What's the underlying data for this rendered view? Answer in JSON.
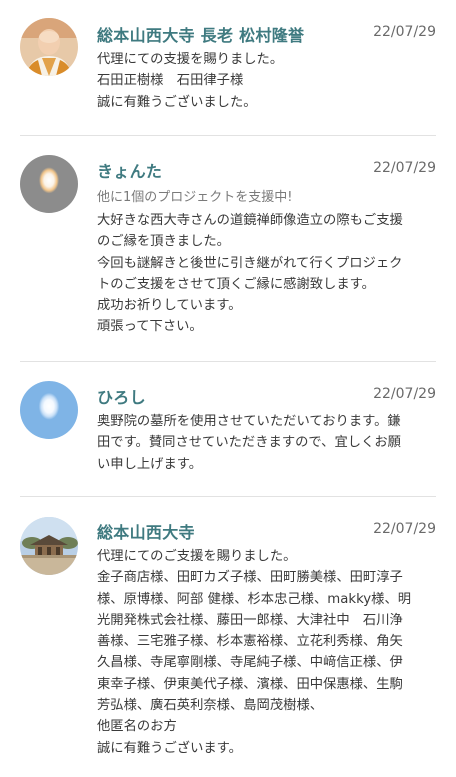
{
  "comments": [
    {
      "name": "総本山西大寺 長老 松村隆誉",
      "date": "22/07/29",
      "avatar": "monk-photo",
      "support_note": "",
      "lines": [
        "代理にての支援を賜りました。",
        "石田正樹様　石田律子様",
        "誠に有難うございました。"
      ]
    },
    {
      "name": "きょんた",
      "date": "22/07/29",
      "avatar": "default-gray-icon",
      "support_note": "他に1個のプロジェクトを支援中!",
      "lines": [
        "大好きな西大寺さんの道鏡禅師像造立の際もご支援",
        "のご縁を頂きました。",
        "今回も謎解きと後世に引き継がれて行くプロジェク",
        "トのご支援をさせて頂くご縁に感謝致します。",
        "成功お祈りしています。",
        "頑張って下さい。"
      ]
    },
    {
      "name": "ひろし",
      "date": "22/07/29",
      "avatar": "default-blue-icon",
      "support_note": "",
      "lines": [
        "奥野院の墓所を使用させていただいております。鎌",
        "田です。賛同させていただきますので、宜しくお願",
        "い申し上げます。"
      ]
    },
    {
      "name": "総本山西大寺",
      "date": "22/07/29",
      "avatar": "temple-photo",
      "support_note": "",
      "lines": [
        "代理にてのご支援を賜りました。",
        "金子商店様、田町カズ子様、田町勝美様、田町淳子",
        "様、原博様、阿部 健様、杉本忠己様、makky様、明",
        "光開発株式会社様、藤田一郎様、大津社中　石川浄",
        "善様、三宅雅子様、杉本憲裕様、立花利秀様、角矢",
        "久昌様、寺尾寧剛様、寺尾純子様、中﨑信正様、伊",
        "東幸子様、伊東美代子様、濱様、田中保惠様、生駒",
        "芳弘様、廣石英利奈様、島岡茂樹様、",
        "他匿名のお方",
        "誠に有難うございます。"
      ]
    }
  ]
}
